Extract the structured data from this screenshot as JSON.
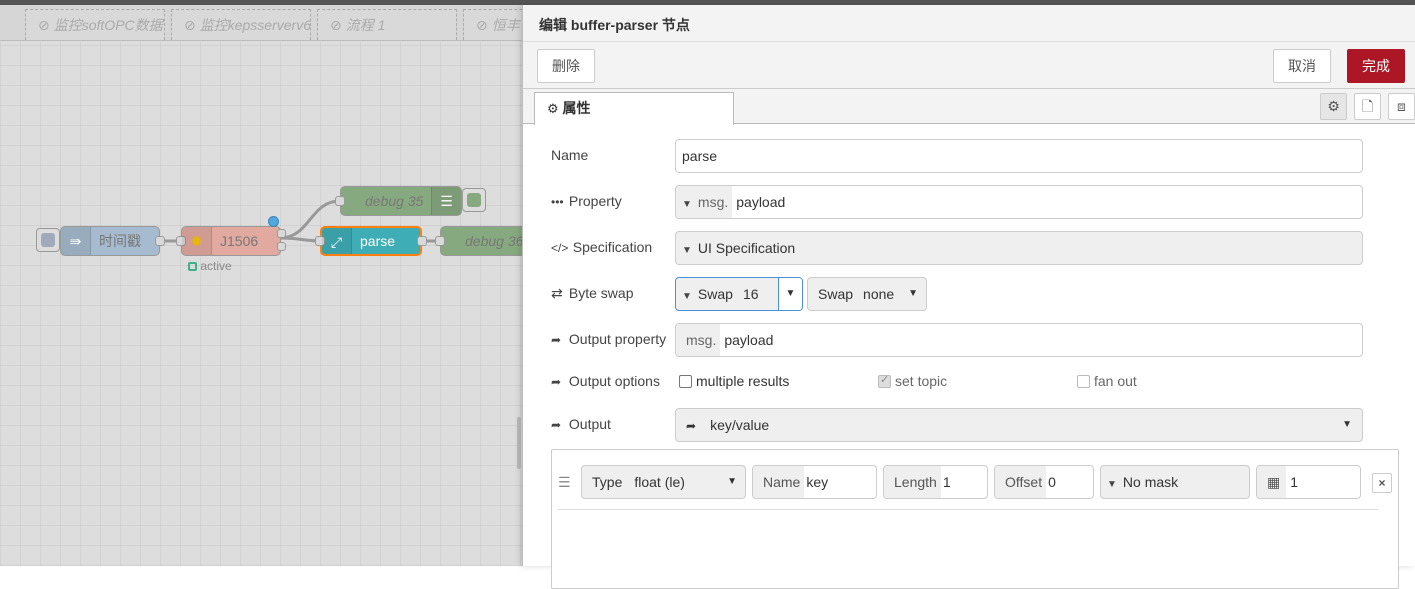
{
  "workspace": {
    "tabs": [
      {
        "label": "监控softOPC数据"
      },
      {
        "label": "监控kepsserverv6"
      },
      {
        "label": "流程 1"
      },
      {
        "label": "恒丰"
      }
    ],
    "nodes": {
      "timestamp": {
        "label": "时间戳"
      },
      "plc": {
        "label": "J1506",
        "status": "active"
      },
      "parse": {
        "label": "parse"
      },
      "debug_top": {
        "label": "debug 35"
      },
      "debug_right": {
        "label": "debug 36"
      }
    }
  },
  "editor": {
    "title": "编辑 buffer-parser 节点",
    "delete_label": "删除",
    "cancel_label": "取消",
    "done_label": "完成",
    "tab_label": "属性",
    "name": {
      "label": "Name",
      "value": "parse"
    },
    "property": {
      "label": "Property",
      "prefix": "msg.",
      "value": "payload"
    },
    "specification": {
      "label": "Specification",
      "value": "UI Specification"
    },
    "byteswap": {
      "label": "Byte swap",
      "swap1_prefix": "Swap",
      "swap1_value": "16",
      "swap2_prefix": "Swap",
      "swap2_value": "none"
    },
    "output_property": {
      "label": "Output property",
      "prefix": "msg.",
      "value": "payload"
    },
    "output_options": {
      "label": "Output options",
      "multiple_results": "multiple results",
      "set_topic": "set topic",
      "fan_out": "fan out"
    },
    "output": {
      "label": "Output",
      "value": "key/value"
    },
    "item": {
      "type_prefix": "Type",
      "type_value": "float (le)",
      "name_prefix": "Name",
      "name_value": "key",
      "length_prefix": "Length",
      "length_value": "1",
      "offset_prefix": "Offset",
      "offset_value": "0",
      "mask_value": "No mask",
      "scale_value": "1"
    }
  },
  "colors": {
    "primary": "#ad1625",
    "parse_node": "#3fadb5",
    "debug_node": "#87a980",
    "plc_node": "#e2a9a0",
    "timestamp_node": "#a6bbcf"
  }
}
